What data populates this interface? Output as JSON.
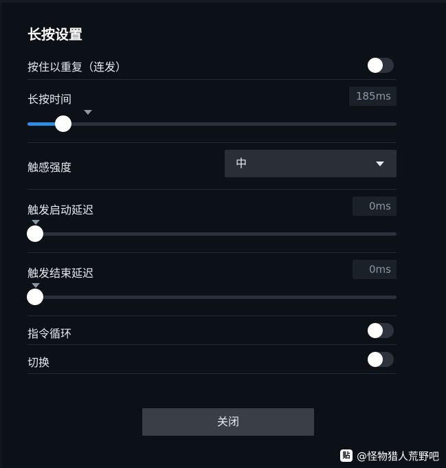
{
  "panel": {
    "title": "长按设置",
    "hold_to_repeat": {
      "label": "按住以重复（连发）",
      "enabled": false
    },
    "long_press_time": {
      "label": "长按时间",
      "value_text": "185ms",
      "value_fraction": 0.08
    },
    "haptic_strength": {
      "label": "触感强度",
      "selected": "中"
    },
    "trigger_start_delay": {
      "label": "触发启动延迟",
      "value_text": "0ms",
      "value_fraction": 0
    },
    "trigger_end_delay": {
      "label": "触发结束延迟",
      "value_text": "0ms",
      "value_fraction": 0
    },
    "command_loop": {
      "label": "指令循环",
      "enabled": false
    },
    "switch": {
      "label": "切换",
      "enabled": false
    },
    "close_label": "关闭"
  },
  "watermark": {
    "icon_text": "贴",
    "text": "@怪物猎人荒野吧"
  },
  "colors": {
    "background": "#0c1118",
    "accent": "#2f8de4",
    "divider": "#222a34"
  }
}
